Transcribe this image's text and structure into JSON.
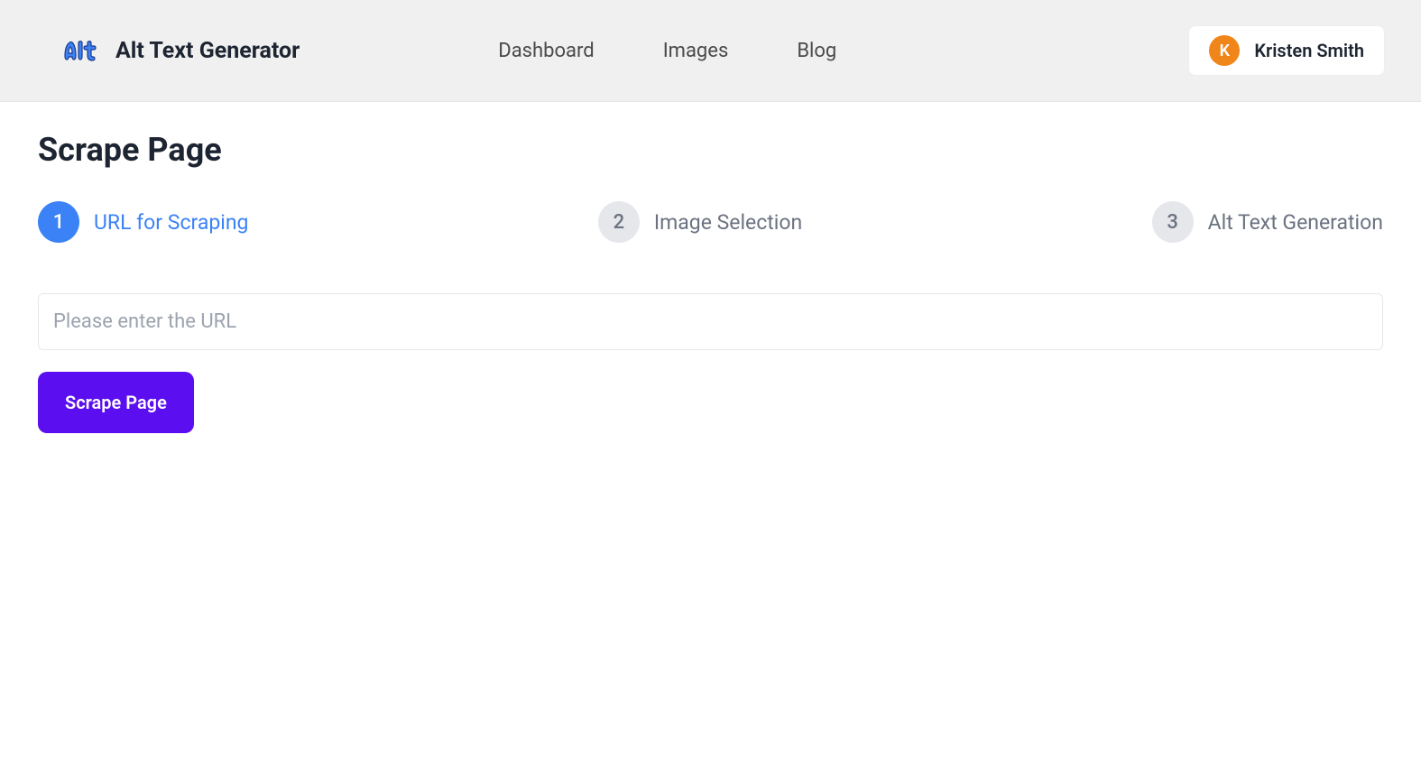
{
  "header": {
    "app_title": "Alt Text Generator",
    "nav": [
      {
        "label": "Dashboard"
      },
      {
        "label": "Images"
      },
      {
        "label": "Blog"
      }
    ],
    "user": {
      "initial": "K",
      "name": "Kristen Smith"
    }
  },
  "main": {
    "page_title": "Scrape Page",
    "steps": [
      {
        "number": "1",
        "label": "URL for Scraping",
        "active": true
      },
      {
        "number": "2",
        "label": "Image Selection",
        "active": false
      },
      {
        "number": "3",
        "label": "Alt Text Generation",
        "active": false
      }
    ],
    "url_input": {
      "placeholder": "Please enter the URL",
      "value": ""
    },
    "scrape_button_label": "Scrape Page"
  }
}
